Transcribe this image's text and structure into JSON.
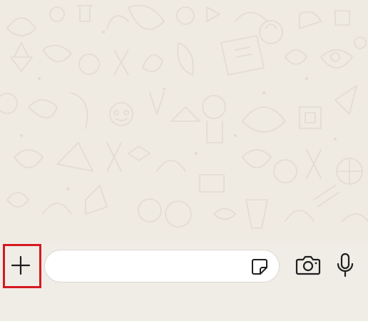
{
  "theme": {
    "wallpaper_bg": "#efeae2",
    "doodle_stroke": "#e2dbd0",
    "bar_bg": "#f0ede7",
    "icon_color": "#1f1f1f",
    "highlight_color": "#d71920"
  },
  "composer": {
    "attach_icon": "plus-icon",
    "message_value": "",
    "sticker_icon": "sticker-icon",
    "camera_icon": "camera-icon",
    "mic_icon": "microphone-icon"
  }
}
